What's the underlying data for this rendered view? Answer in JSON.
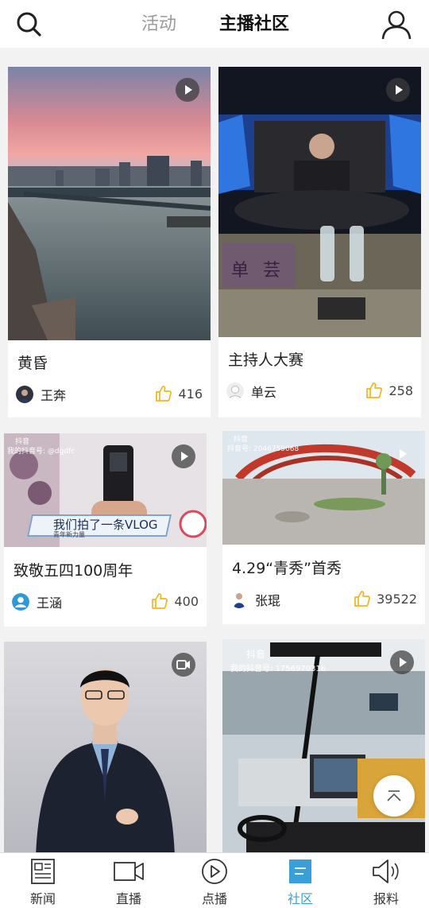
{
  "header": {
    "tab_activity": "活动",
    "tab_community": "主播社区",
    "search_icon": "search-icon",
    "profile_icon": "user-icon"
  },
  "colors": {
    "accent": "#3a9fd8",
    "like": "#f2b51f",
    "inactive_tab": "#9a9a9a"
  },
  "cards": [
    {
      "title": "黄昏",
      "author": "王奔",
      "likes": "416",
      "badge": "play-icon"
    },
    {
      "title": "主持人大赛",
      "author": "单云",
      "likes": "258",
      "badge": "play-icon"
    },
    {
      "title": "致敬五四100周年",
      "author": "王涵",
      "likes": "400",
      "badge": "play-icon"
    },
    {
      "title": "4.29“青秀”首秀",
      "author": "张琨",
      "likes": "39522",
      "badge": "play-icon"
    },
    {
      "title": "",
      "author": "",
      "likes": "",
      "badge": "video-camera-icon"
    },
    {
      "title": "",
      "author": "",
      "likes": "",
      "badge": "play-icon"
    }
  ],
  "overlays": {
    "vlog_text": "我们拍了一条VLOG",
    "vlog_sub": "青年新力量",
    "douyin_label": "抖音",
    "douyin_id_card3": "我的抖音号: @dgdfc",
    "douyin_id_card4": "抖音号: 2046759068",
    "douyin_id_card6": "我的抖音号: 1756970316",
    "sign_text": "单芸"
  },
  "nav": [
    {
      "label": "新闻",
      "icon": "news-icon"
    },
    {
      "label": "直播",
      "icon": "live-icon"
    },
    {
      "label": "点播",
      "icon": "play-circle-icon"
    },
    {
      "label": "社区",
      "icon": "community-icon"
    },
    {
      "label": "报料",
      "icon": "megaphone-icon"
    }
  ]
}
